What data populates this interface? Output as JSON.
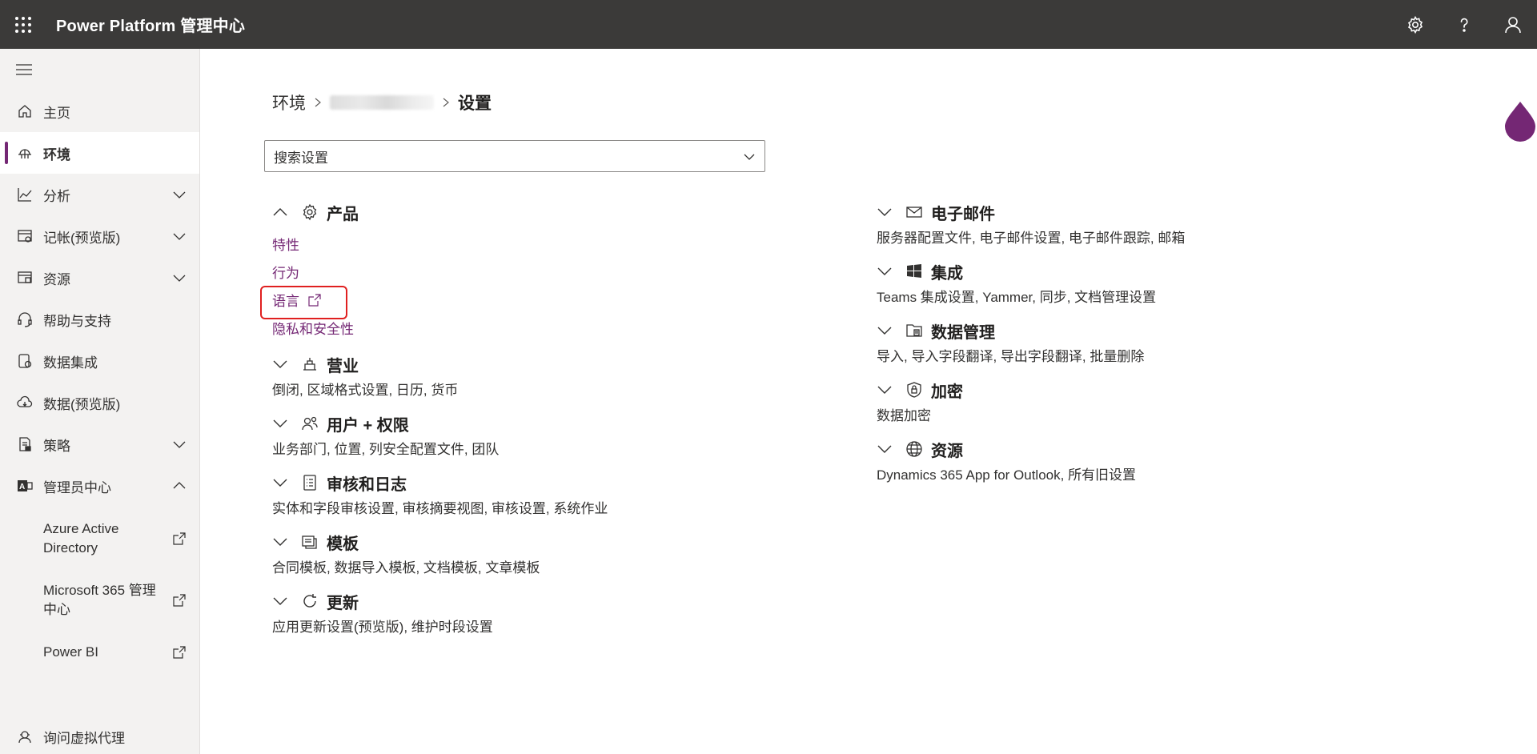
{
  "header": {
    "title": "Power Platform 管理中心"
  },
  "sidebar": {
    "items": [
      {
        "label": "主页",
        "icon": "home-icon",
        "active": false,
        "chevron": ""
      },
      {
        "label": "环境",
        "icon": "environment-icon",
        "active": true,
        "chevron": ""
      },
      {
        "label": "分析",
        "icon": "analytics-icon",
        "active": false,
        "chevron": "down"
      },
      {
        "label": "记帐(预览版)",
        "icon": "billing-icon",
        "active": false,
        "chevron": "down"
      },
      {
        "label": "资源",
        "icon": "resources-icon",
        "active": false,
        "chevron": "down"
      },
      {
        "label": "帮助与支持",
        "icon": "headset-icon",
        "active": false,
        "chevron": ""
      },
      {
        "label": "数据集成",
        "icon": "data-integration-icon",
        "active": false,
        "chevron": ""
      },
      {
        "label": "数据(预览版)",
        "icon": "cloud-data-icon",
        "active": false,
        "chevron": ""
      },
      {
        "label": "策略",
        "icon": "policy-icon",
        "active": false,
        "chevron": "down"
      },
      {
        "label": "管理员中心",
        "icon": "admin-center-icon",
        "active": false,
        "chevron": "up"
      }
    ],
    "sub_items": [
      {
        "label": "Azure Active Directory"
      },
      {
        "label": "Microsoft 365 管理中心"
      },
      {
        "label": "Power BI"
      }
    ],
    "bottom_item": {
      "label": "询问虚拟代理"
    }
  },
  "breadcrumb": {
    "root": "环境",
    "current": "设置"
  },
  "search": {
    "placeholder": "搜索设置"
  },
  "sections_left": {
    "product": {
      "title": "产品",
      "links": [
        "特性",
        "行为",
        "语言",
        "隐私和安全性"
      ]
    },
    "business": {
      "title": "营业",
      "desc": "倒闭, 区域格式设置, 日历, 货币"
    },
    "users": {
      "title": "用户 + 权限",
      "desc": "业务部门, 位置, 列安全配置文件, 团队"
    },
    "audit": {
      "title": "审核和日志",
      "desc": "实体和字段审核设置, 审核摘要视图, 审核设置, 系统作业"
    },
    "templates": {
      "title": "模板",
      "desc": "合同模板, 数据导入模板, 文档模板, 文章模板"
    },
    "updates": {
      "title": "更新",
      "desc": "应用更新设置(预览版), 维护时段设置"
    }
  },
  "sections_right": {
    "email": {
      "title": "电子邮件",
      "desc": "服务器配置文件, 电子邮件设置, 电子邮件跟踪, 邮箱"
    },
    "integration": {
      "title": "集成",
      "desc": "Teams 集成设置, Yammer, 同步, 文档管理设置"
    },
    "data_management": {
      "title": "数据管理",
      "desc": "导入, 导入字段翻译, 导出字段翻译, 批量删除"
    },
    "encryption": {
      "title": "加密",
      "desc": "数据加密"
    },
    "resources": {
      "title": "资源",
      "desc": "Dynamics 365 App for Outlook, 所有旧设置"
    }
  },
  "colors": {
    "topbar": "#3b3a39",
    "accent": "#742774",
    "highlight": "#e02020"
  }
}
